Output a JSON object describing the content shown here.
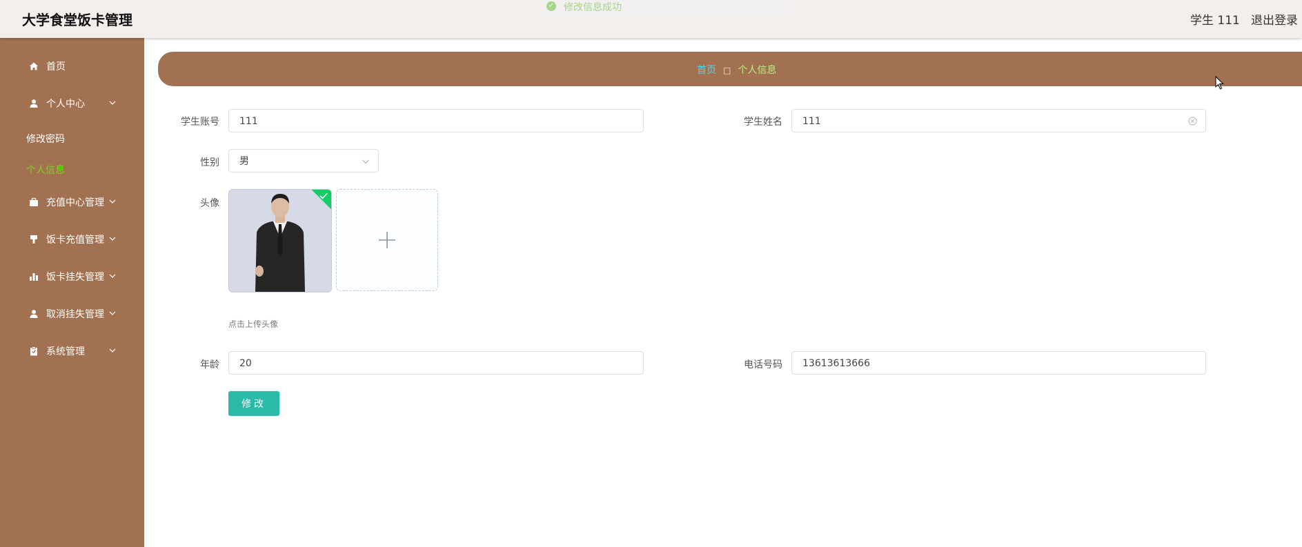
{
  "header": {
    "app_title": "大学食堂饭卡管理",
    "user_label": "学生 111",
    "logout_label": "退出登录"
  },
  "toast": {
    "message": "修改信息成功"
  },
  "sidebar": {
    "items": [
      {
        "label": "首页",
        "icon": "home-icon"
      },
      {
        "label": "个人中心",
        "icon": "user-icon",
        "expanded": true,
        "children": [
          {
            "label": "修改密码",
            "active": false
          },
          {
            "label": "个人信息",
            "active": true
          }
        ]
      },
      {
        "label": "充值中心管理",
        "icon": "briefcase-icon"
      },
      {
        "label": "饭卡充值管理",
        "icon": "brush-icon"
      },
      {
        "label": "饭卡挂失管理",
        "icon": "bar-chart-icon"
      },
      {
        "label": "取消挂失管理",
        "icon": "user-icon"
      },
      {
        "label": "系统管理",
        "icon": "clipboard-icon"
      }
    ]
  },
  "breadcrumb": {
    "home": "首页",
    "separator": "□",
    "current": "个人信息"
  },
  "form": {
    "account_label": "学生账号",
    "account_value": "111",
    "name_label": "学生姓名",
    "name_value": "111",
    "gender_label": "性别",
    "gender_value": "男",
    "avatar_label": "头像",
    "upload_tip": "点击上传头像",
    "age_label": "年龄",
    "age_value": "20",
    "phone_label": "电话号码",
    "phone_value": "13613613666",
    "submit_label": "修改"
  },
  "colors": {
    "sidebar_bg": "#a27151",
    "header_bg": "#f4eeec",
    "active_submenu": "#7fd321",
    "crumb_home": "#5bd3e8",
    "crumb_current": "#b8f07a",
    "submit_button": "#2cbaa8",
    "upload_success": "#13ce66"
  }
}
